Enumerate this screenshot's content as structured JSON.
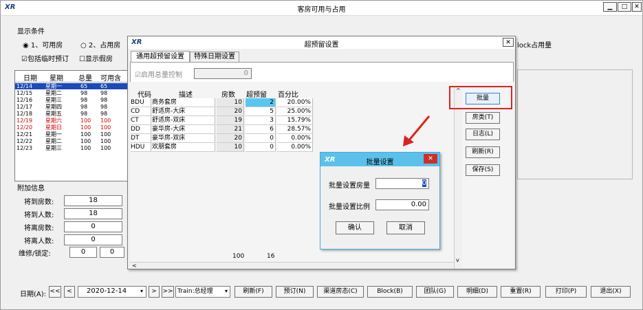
{
  "window": {
    "title": "客房可用与占用",
    "logo": "XR"
  },
  "display_conditions": {
    "title": "显示条件",
    "radio1": "1、可用房",
    "radio2": "2、占用房",
    "checkbox1": "包括临时预订",
    "checkbox2": "显示假房",
    "block_label": "lock占用量"
  },
  "grid": {
    "headers": [
      "日期",
      "星期",
      "总量",
      "可用含"
    ],
    "rows": [
      {
        "date": "12/14",
        "week": "星期一",
        "total": "65",
        "avail": "65"
      },
      {
        "date": "12/15",
        "week": "星期二",
        "total": "98",
        "avail": "98"
      },
      {
        "date": "12/16",
        "week": "星期三",
        "total": "98",
        "avail": "98"
      },
      {
        "date": "12/17",
        "week": "星期四",
        "total": "98",
        "avail": "98"
      },
      {
        "date": "12/18",
        "week": "星期五",
        "total": "98",
        "avail": "98"
      },
      {
        "date": "12/19",
        "week": "星期六",
        "total": "100",
        "avail": "100"
      },
      {
        "date": "12/20",
        "week": "星期日",
        "total": "100",
        "avail": "100"
      },
      {
        "date": "12/21",
        "week": "星期一",
        "total": "100",
        "avail": "100"
      },
      {
        "date": "12/22",
        "week": "星期二",
        "total": "100",
        "avail": "100"
      },
      {
        "date": "12/23",
        "week": "星期三",
        "total": "100",
        "avail": "100"
      }
    ]
  },
  "additional": {
    "title": "附加信息",
    "arrive_rooms_label": "将到房数:",
    "arrive_rooms": "18",
    "arrive_people_label": "将到人数:",
    "arrive_people": "18",
    "depart_rooms_label": "将离房数:",
    "depart_rooms": "0",
    "depart_people_label": "将离人数:",
    "depart_people": "0",
    "maint_label": "维修/锁定:",
    "maint_a": "0",
    "maint_b": "0"
  },
  "bottom": {
    "date_label": "日期(A):",
    "date_value": "2020-12-14",
    "train": "Train:总经理",
    "buttons": [
      "刷新(F)",
      "预订(N)",
      "渠道房态(C)",
      "Block(B)",
      "团队(G)",
      "明细(D)",
      "重置(R)",
      "打印(P)",
      "退出(X)"
    ]
  },
  "overbooking": {
    "title": "超预留设置",
    "tab1": "通用超预留设置",
    "tab2": "特殊日期设置",
    "enable_total": "启用总量控制",
    "total_value": "0",
    "headers": [
      "代码",
      "描述",
      "房数",
      "超预留",
      "百分比"
    ],
    "rows": [
      {
        "code": "BDU",
        "desc": "商务套房",
        "rooms": "10",
        "over": "2",
        "pct": "20.00%"
      },
      {
        "code": "CD",
        "desc": "舒适房-大床",
        "rooms": "20",
        "over": "5",
        "pct": "25.00%"
      },
      {
        "code": "CT",
        "desc": "舒适房-双床",
        "rooms": "19",
        "over": "3",
        "pct": "15.79%"
      },
      {
        "code": "DD",
        "desc": "豪华房-大床",
        "rooms": "21",
        "over": "6",
        "pct": "28.57%"
      },
      {
        "code": "DT",
        "desc": "豪华房-双床",
        "rooms": "20",
        "over": "0",
        "pct": "0.00%"
      },
      {
        "code": "HDU",
        "desc": "欢朋套房",
        "rooms": "10",
        "over": "0",
        "pct": "0.00%"
      }
    ],
    "sum_rooms": "100",
    "sum_over": "16",
    "side_buttons": [
      "批量",
      "房类(T)",
      "日志(L)",
      "刷新(R)",
      "保存(S)"
    ]
  },
  "batch": {
    "title": "批量设置",
    "rooms_label": "批量设置房量",
    "rooms_value": "0",
    "ratio_label": "批量设置比例",
    "ratio_value": "0.00",
    "ok": "确认",
    "cancel": "取消"
  },
  "colors": {
    "selected_row": "#1c4ab8",
    "weekend_red": "#d40000",
    "highlight_box": "#e02020",
    "batch_title": "#5bc1ea"
  }
}
